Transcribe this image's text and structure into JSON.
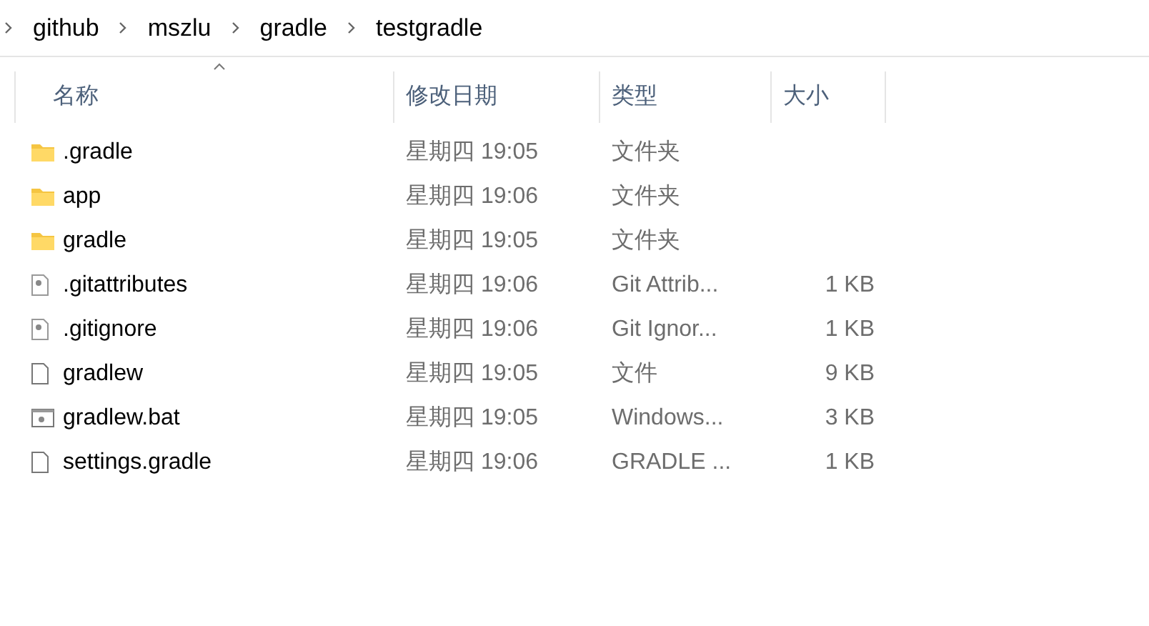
{
  "breadcrumb": [
    "github",
    "mszlu",
    "gradle",
    "testgradle"
  ],
  "columns": [
    {
      "label": "名称",
      "sorted": true
    },
    {
      "label": "修改日期",
      "sorted": false
    },
    {
      "label": "类型",
      "sorted": false
    },
    {
      "label": "大小",
      "sorted": false
    }
  ],
  "rows": [
    {
      "kind": "folder",
      "name": ".gradle",
      "modified": "星期四 19:05",
      "type": "文件夹"
    },
    {
      "kind": "folder",
      "name": "app",
      "modified": "星期四 19:06",
      "type": "文件夹"
    },
    {
      "kind": "folder",
      "name": "gradle",
      "modified": "星期四 19:05",
      "type": "文件夹"
    },
    {
      "kind": "config",
      "name": ".gitattributes",
      "modified": "星期四 19:06",
      "type": "Git Attrib...",
      "size": "1 KB"
    },
    {
      "kind": "config",
      "name": ".gitignore",
      "modified": "星期四 19:06",
      "type": "Git Ignor...",
      "size": "1 KB"
    },
    {
      "kind": "file",
      "name": "gradlew",
      "modified": "星期四 19:05",
      "type": "文件",
      "size": "9 KB"
    },
    {
      "kind": "batch",
      "name": "gradlew.bat",
      "modified": "星期四 19:05",
      "type": "Windows...",
      "size": "3 KB"
    },
    {
      "kind": "file",
      "name": "settings.gradle",
      "modified": "星期四 19:06",
      "type": "GRADLE ...",
      "size": "1 KB"
    }
  ]
}
